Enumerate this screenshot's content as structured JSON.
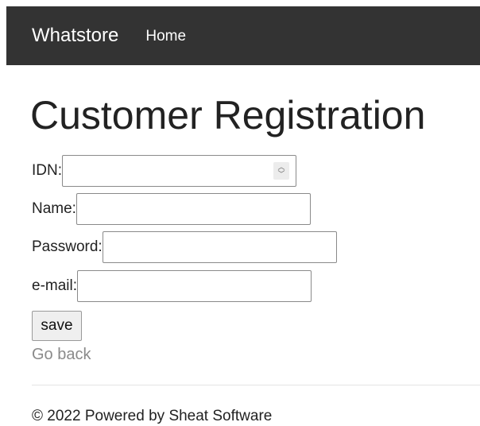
{
  "navbar": {
    "brand": "Whatstore",
    "links": [
      {
        "label": "Home"
      }
    ]
  },
  "main": {
    "title": "Customer Registration",
    "form": {
      "idn": {
        "label": "IDN:",
        "value": ""
      },
      "name": {
        "label": "Name:",
        "value": ""
      },
      "password": {
        "label": "Password:",
        "value": ""
      },
      "email": {
        "label": "e-mail:",
        "value": ""
      },
      "save_label": "save"
    },
    "back_link": "Go back"
  },
  "footer": {
    "text": "© 2022 Powered by Sheat Software"
  },
  "colors": {
    "navbar_bg": "#333333",
    "link_muted": "#8a8a8a"
  }
}
